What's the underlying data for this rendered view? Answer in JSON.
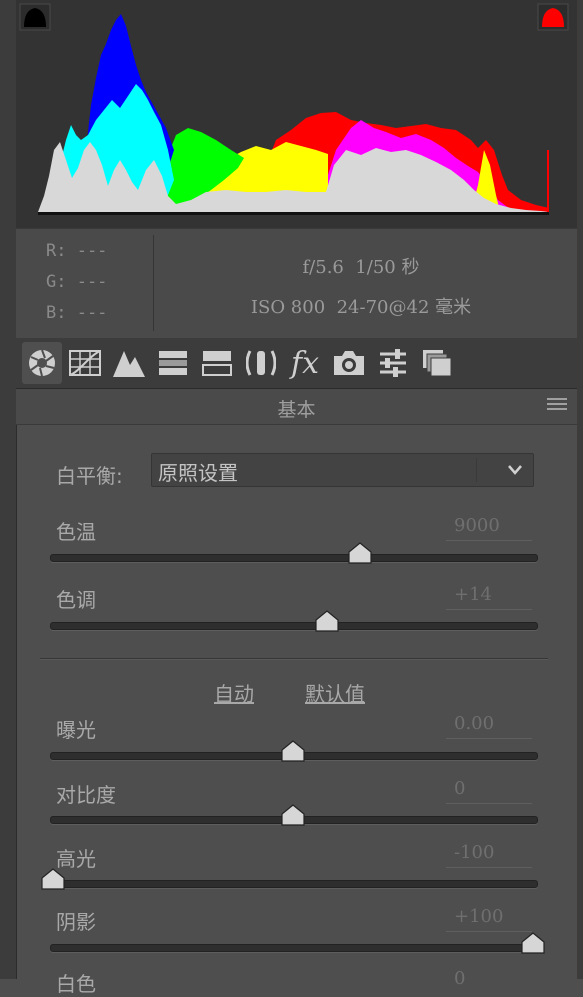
{
  "histogram": {
    "label": "histogram",
    "shadow_clip_color": "#000000",
    "highlight_clip_color": "#ff0000"
  },
  "metadata": {
    "r_label": "R: ---",
    "g_label": "G: ---",
    "b_label": "B: ---",
    "line1": "f/5.6  1/50 秒",
    "line2": "ISO 800  24-70@42 毫米"
  },
  "toolbar": {
    "tools": [
      {
        "name": "basic",
        "icon": "aperture-icon",
        "active": true
      },
      {
        "name": "tone-curve",
        "icon": "grid-curve-icon"
      },
      {
        "name": "detail",
        "icon": "mountains-icon"
      },
      {
        "name": "hsl",
        "icon": "bars-icon"
      },
      {
        "name": "split-toning",
        "icon": "split-icon"
      },
      {
        "name": "lens",
        "icon": "lens-icon"
      },
      {
        "name": "effects",
        "icon": "fx-icon"
      },
      {
        "name": "camera-calibration",
        "icon": "camera-icon"
      },
      {
        "name": "presets",
        "icon": "sliders-icon"
      },
      {
        "name": "snapshots",
        "icon": "stack-icon"
      }
    ]
  },
  "panel": {
    "title": "基本",
    "white_balance": {
      "label": "白平衡:",
      "value": "原照设置"
    },
    "auto_link": "自动",
    "default_link": "默认值",
    "sliders": {
      "temp": {
        "label": "色温",
        "value": "9000",
        "position": 0.64
      },
      "tint": {
        "label": "色调",
        "value": "+14",
        "position": 0.57
      },
      "exposure": {
        "label": "曝光",
        "value": "0.00",
        "position": 0.5
      },
      "contrast": {
        "label": "对比度",
        "value": "0",
        "position": 0.5
      },
      "highlights": {
        "label": "高光",
        "value": "-100",
        "position": 0.0
      },
      "shadows": {
        "label": "阴影",
        "value": "+100",
        "position": 1.0
      },
      "whites": {
        "label": "白色",
        "value": "0"
      }
    }
  }
}
